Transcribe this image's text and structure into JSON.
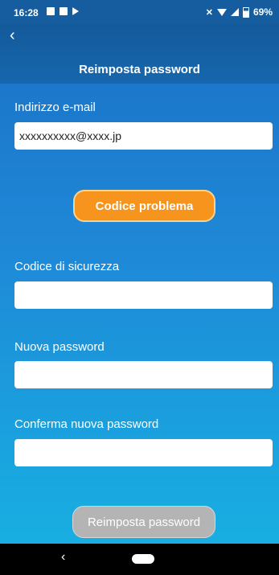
{
  "status_bar": {
    "time": "16:28",
    "battery": "69%"
  },
  "header": {
    "back_glyph": "‹",
    "title": "Reimposta password"
  },
  "form": {
    "email_label": "Indirizzo e-mail",
    "email_value": "xxxxxxxxxx@xxxx.jp",
    "code_button_label": "Codice problema",
    "security_code_label": "Codice di sicurezza",
    "security_code_value": "",
    "new_password_label": "Nuova password",
    "new_password_value": "",
    "confirm_password_label": "Conferma nuova password",
    "confirm_password_value": "",
    "reset_button_label": "Reimposta password"
  },
  "nav_bar": {
    "back_glyph": "‹"
  },
  "colors": {
    "accent_orange": "#f7941d",
    "header_blue": "#135a9a",
    "disabled_gray": "#b4b4b4"
  }
}
